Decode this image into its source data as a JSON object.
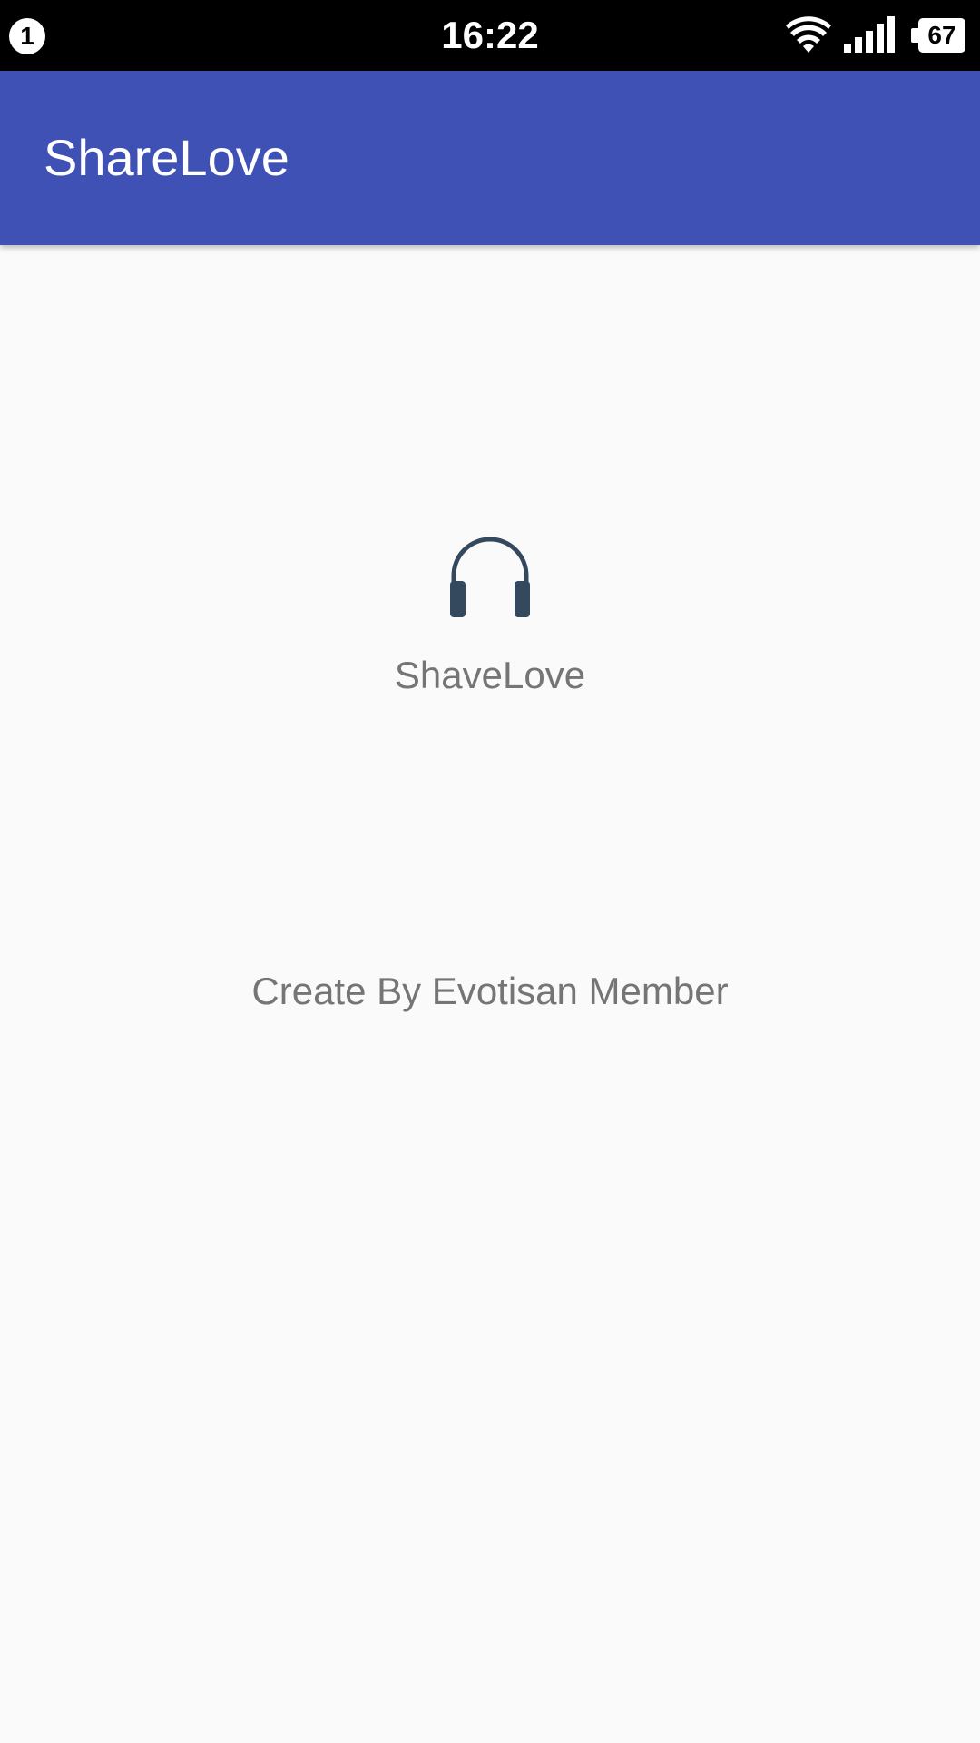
{
  "status_bar": {
    "notification_count": "1",
    "time": "16:22",
    "battery_level": "67",
    "icons": [
      "wifi-icon",
      "signal-icon",
      "battery-icon"
    ]
  },
  "app_bar": {
    "title": "ShareLove",
    "background_color": "#3f51b5"
  },
  "main": {
    "logo_icon": "headphones-icon",
    "logo_label": "ShaveLove",
    "credit_text": "Create By Evotisan Member"
  }
}
